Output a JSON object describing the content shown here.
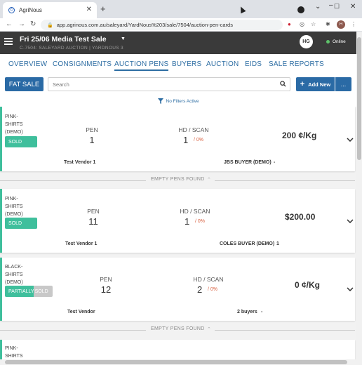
{
  "browser": {
    "tab_title": "AgriNous",
    "url": "app.agrinous.com.au/saleyard/YardNous%203/sale/7504/auction-pen-cards",
    "profile_initial": "H"
  },
  "header": {
    "sale_title": "Fri 25/06 Media Test Sale",
    "sale_subtitle": "C-7504: SALEYARD AUCTION | YARDNOUS 3",
    "user_initials": "HG",
    "status": "Online"
  },
  "nav": {
    "tabs": [
      "OVERVIEW",
      "CONSIGNMENTS",
      "AUCTION PENS",
      "BUYERS",
      "AUCTION",
      "EIDS",
      "SALE REPORTS"
    ],
    "active": "AUCTION PENS"
  },
  "toolbar": {
    "mode_label": "FAT SALE",
    "search_placeholder": "Search",
    "add_new_label": "Add New",
    "more_label": "..."
  },
  "filters": {
    "label": "No Filters Active"
  },
  "labels": {
    "pen": "PEN",
    "hd_scan": "HD / SCAN"
  },
  "divider_label": "EMPTY PENS FOUND",
  "cards": [
    {
      "name_lines": [
        "PINK-",
        "SHIRTS",
        "(DEMO)"
      ],
      "status": "SOLD",
      "pen": "1",
      "hd": "1",
      "pct": "/ 0%",
      "price": "200 ¢/Kg",
      "vendor": "Test Vendor 1",
      "buyer": "JBS BUYER (DEMO)",
      "buyer_suffix": "-"
    },
    {
      "name_lines": [
        "PINK-",
        "SHIRTS",
        "(DEMO)"
      ],
      "status": "SOLD",
      "pen": "11",
      "hd": "1",
      "pct": "/ 0%",
      "price": "$200.00",
      "vendor": "Test Vendor 1",
      "buyer": "COLES BUYER (DEMO)",
      "buyer_suffix": "1"
    },
    {
      "name_lines": [
        "BLACK-",
        "SHIRTS",
        "(DEMO)"
      ],
      "status_part1": "PARTIALLY",
      "status_part2": "SOLD",
      "pen": "12",
      "hd": "2",
      "pct": "/ 0%",
      "price": "0 ¢/Kg",
      "vendor": "Test Vendor",
      "buyer": "2 buyers",
      "buyer_suffix": "-"
    },
    {
      "name_lines": [
        "PINK-",
        "SHIRTS"
      ]
    }
  ]
}
